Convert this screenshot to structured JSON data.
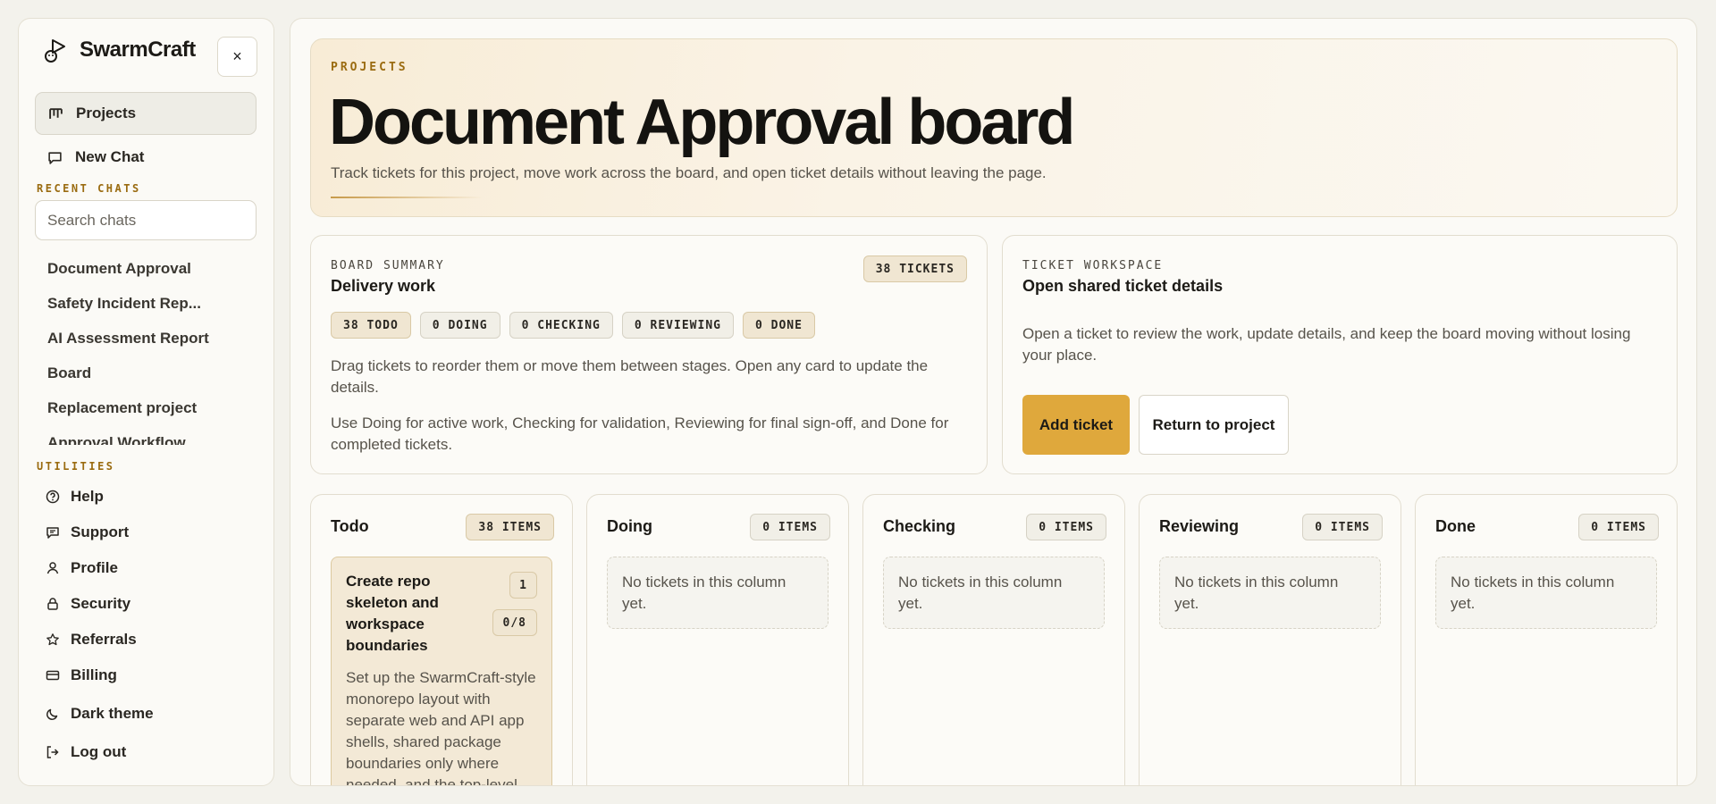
{
  "app": {
    "name": "SwarmCraft"
  },
  "sidebar": {
    "close_label": "×",
    "nav": [
      {
        "label": "Projects",
        "icon": "board-icon",
        "active": true
      },
      {
        "label": "New Chat",
        "icon": "chat-icon",
        "active": false
      }
    ],
    "recent_chats_label": "RECENT CHATS",
    "search": {
      "placeholder": "Search chats",
      "value": ""
    },
    "chats": [
      "Document Approval",
      "Safety Incident Rep...",
      "AI Assessment Report",
      "Board",
      "Replacement project",
      "Approval Workflow"
    ],
    "utilities_label": "UTILITIES",
    "utilities": [
      {
        "label": "Help",
        "icon": "help-icon"
      },
      {
        "label": "Support",
        "icon": "support-icon"
      },
      {
        "label": "Profile",
        "icon": "profile-icon"
      },
      {
        "label": "Security",
        "icon": "lock-icon"
      },
      {
        "label": "Referrals",
        "icon": "star-icon"
      },
      {
        "label": "Billing",
        "icon": "card-icon"
      },
      {
        "label": "Dark theme",
        "icon": "moon-icon"
      },
      {
        "label": "Log out",
        "icon": "logout-icon"
      }
    ]
  },
  "hero": {
    "label": "PROJECTS",
    "title": "Document Approval board",
    "subtitle": "Track tickets for this project, move work across the board, and open ticket details without leaving the page."
  },
  "summary": {
    "label": "BOARD SUMMARY",
    "title": "Delivery work",
    "tickets_badge": "38 TICKETS",
    "stages": [
      "38 TODO",
      "0 DOING",
      "0 CHECKING",
      "0 REVIEWING",
      "0 DONE"
    ],
    "text1": "Drag tickets to reorder them or move them between stages. Open any card to update the details.",
    "text2": "Use Doing for active work, Checking for validation, Reviewing for final sign-off, and Done for completed tickets."
  },
  "workspace": {
    "label": "TICKET WORKSPACE",
    "title": "Open shared ticket details",
    "text": "Open a ticket to review the work, update details, and keep the board moving without losing your place.",
    "add_label": "Add ticket",
    "return_label": "Return to project"
  },
  "columns": [
    {
      "title": "Todo",
      "count": "38 ITEMS"
    },
    {
      "title": "Doing",
      "count": "0 ITEMS"
    },
    {
      "title": "Checking",
      "count": "0 ITEMS"
    },
    {
      "title": "Reviewing",
      "count": "0 ITEMS"
    },
    {
      "title": "Done",
      "count": "0 ITEMS"
    }
  ],
  "empty_text": "No tickets in this column yet.",
  "ticket": {
    "title": "Create repo skeleton and workspace boundaries",
    "number": "1",
    "progress": "0/8",
    "description": "Set up the SwarmCraft-style monorepo layout with separate web and API app shells, shared package boundaries only where needed, and the top-level"
  },
  "colors": {
    "accent": "#dfa83c",
    "label": "#9a6b10",
    "background": "#f3f2ec"
  }
}
